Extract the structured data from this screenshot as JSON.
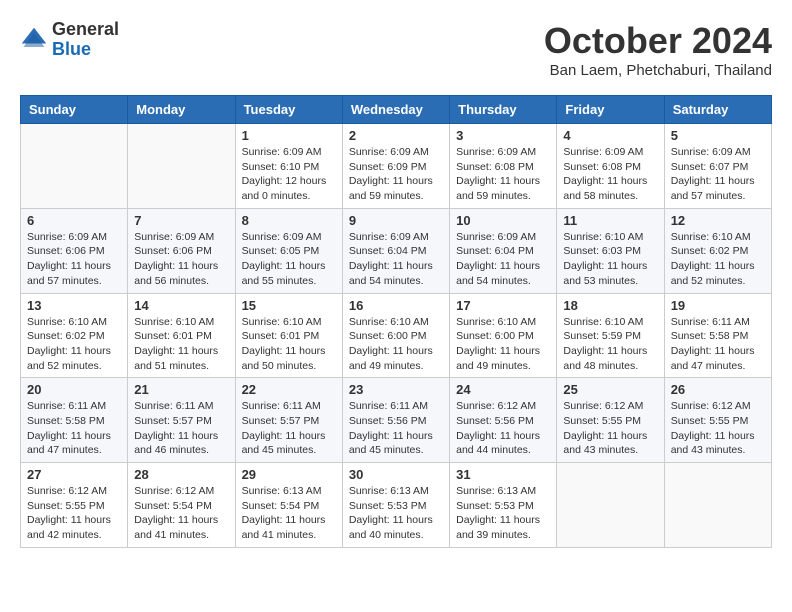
{
  "header": {
    "logo": {
      "line1": "General",
      "line2": "Blue"
    },
    "title": "October 2024",
    "subtitle": "Ban Laem, Phetchaburi, Thailand"
  },
  "weekdays": [
    "Sunday",
    "Monday",
    "Tuesday",
    "Wednesday",
    "Thursday",
    "Friday",
    "Saturday"
  ],
  "weeks": [
    [
      {
        "day": "",
        "info": ""
      },
      {
        "day": "",
        "info": ""
      },
      {
        "day": "1",
        "info": "Sunrise: 6:09 AM\nSunset: 6:10 PM\nDaylight: 12 hours\nand 0 minutes."
      },
      {
        "day": "2",
        "info": "Sunrise: 6:09 AM\nSunset: 6:09 PM\nDaylight: 11 hours\nand 59 minutes."
      },
      {
        "day": "3",
        "info": "Sunrise: 6:09 AM\nSunset: 6:08 PM\nDaylight: 11 hours\nand 59 minutes."
      },
      {
        "day": "4",
        "info": "Sunrise: 6:09 AM\nSunset: 6:08 PM\nDaylight: 11 hours\nand 58 minutes."
      },
      {
        "day": "5",
        "info": "Sunrise: 6:09 AM\nSunset: 6:07 PM\nDaylight: 11 hours\nand 57 minutes."
      }
    ],
    [
      {
        "day": "6",
        "info": "Sunrise: 6:09 AM\nSunset: 6:06 PM\nDaylight: 11 hours\nand 57 minutes."
      },
      {
        "day": "7",
        "info": "Sunrise: 6:09 AM\nSunset: 6:06 PM\nDaylight: 11 hours\nand 56 minutes."
      },
      {
        "day": "8",
        "info": "Sunrise: 6:09 AM\nSunset: 6:05 PM\nDaylight: 11 hours\nand 55 minutes."
      },
      {
        "day": "9",
        "info": "Sunrise: 6:09 AM\nSunset: 6:04 PM\nDaylight: 11 hours\nand 54 minutes."
      },
      {
        "day": "10",
        "info": "Sunrise: 6:09 AM\nSunset: 6:04 PM\nDaylight: 11 hours\nand 54 minutes."
      },
      {
        "day": "11",
        "info": "Sunrise: 6:10 AM\nSunset: 6:03 PM\nDaylight: 11 hours\nand 53 minutes."
      },
      {
        "day": "12",
        "info": "Sunrise: 6:10 AM\nSunset: 6:02 PM\nDaylight: 11 hours\nand 52 minutes."
      }
    ],
    [
      {
        "day": "13",
        "info": "Sunrise: 6:10 AM\nSunset: 6:02 PM\nDaylight: 11 hours\nand 52 minutes."
      },
      {
        "day": "14",
        "info": "Sunrise: 6:10 AM\nSunset: 6:01 PM\nDaylight: 11 hours\nand 51 minutes."
      },
      {
        "day": "15",
        "info": "Sunrise: 6:10 AM\nSunset: 6:01 PM\nDaylight: 11 hours\nand 50 minutes."
      },
      {
        "day": "16",
        "info": "Sunrise: 6:10 AM\nSunset: 6:00 PM\nDaylight: 11 hours\nand 49 minutes."
      },
      {
        "day": "17",
        "info": "Sunrise: 6:10 AM\nSunset: 6:00 PM\nDaylight: 11 hours\nand 49 minutes."
      },
      {
        "day": "18",
        "info": "Sunrise: 6:10 AM\nSunset: 5:59 PM\nDaylight: 11 hours\nand 48 minutes."
      },
      {
        "day": "19",
        "info": "Sunrise: 6:11 AM\nSunset: 5:58 PM\nDaylight: 11 hours\nand 47 minutes."
      }
    ],
    [
      {
        "day": "20",
        "info": "Sunrise: 6:11 AM\nSunset: 5:58 PM\nDaylight: 11 hours\nand 47 minutes."
      },
      {
        "day": "21",
        "info": "Sunrise: 6:11 AM\nSunset: 5:57 PM\nDaylight: 11 hours\nand 46 minutes."
      },
      {
        "day": "22",
        "info": "Sunrise: 6:11 AM\nSunset: 5:57 PM\nDaylight: 11 hours\nand 45 minutes."
      },
      {
        "day": "23",
        "info": "Sunrise: 6:11 AM\nSunset: 5:56 PM\nDaylight: 11 hours\nand 45 minutes."
      },
      {
        "day": "24",
        "info": "Sunrise: 6:12 AM\nSunset: 5:56 PM\nDaylight: 11 hours\nand 44 minutes."
      },
      {
        "day": "25",
        "info": "Sunrise: 6:12 AM\nSunset: 5:55 PM\nDaylight: 11 hours\nand 43 minutes."
      },
      {
        "day": "26",
        "info": "Sunrise: 6:12 AM\nSunset: 5:55 PM\nDaylight: 11 hours\nand 43 minutes."
      }
    ],
    [
      {
        "day": "27",
        "info": "Sunrise: 6:12 AM\nSunset: 5:55 PM\nDaylight: 11 hours\nand 42 minutes."
      },
      {
        "day": "28",
        "info": "Sunrise: 6:12 AM\nSunset: 5:54 PM\nDaylight: 11 hours\nand 41 minutes."
      },
      {
        "day": "29",
        "info": "Sunrise: 6:13 AM\nSunset: 5:54 PM\nDaylight: 11 hours\nand 41 minutes."
      },
      {
        "day": "30",
        "info": "Sunrise: 6:13 AM\nSunset: 5:53 PM\nDaylight: 11 hours\nand 40 minutes."
      },
      {
        "day": "31",
        "info": "Sunrise: 6:13 AM\nSunset: 5:53 PM\nDaylight: 11 hours\nand 39 minutes."
      },
      {
        "day": "",
        "info": ""
      },
      {
        "day": "",
        "info": ""
      }
    ]
  ]
}
